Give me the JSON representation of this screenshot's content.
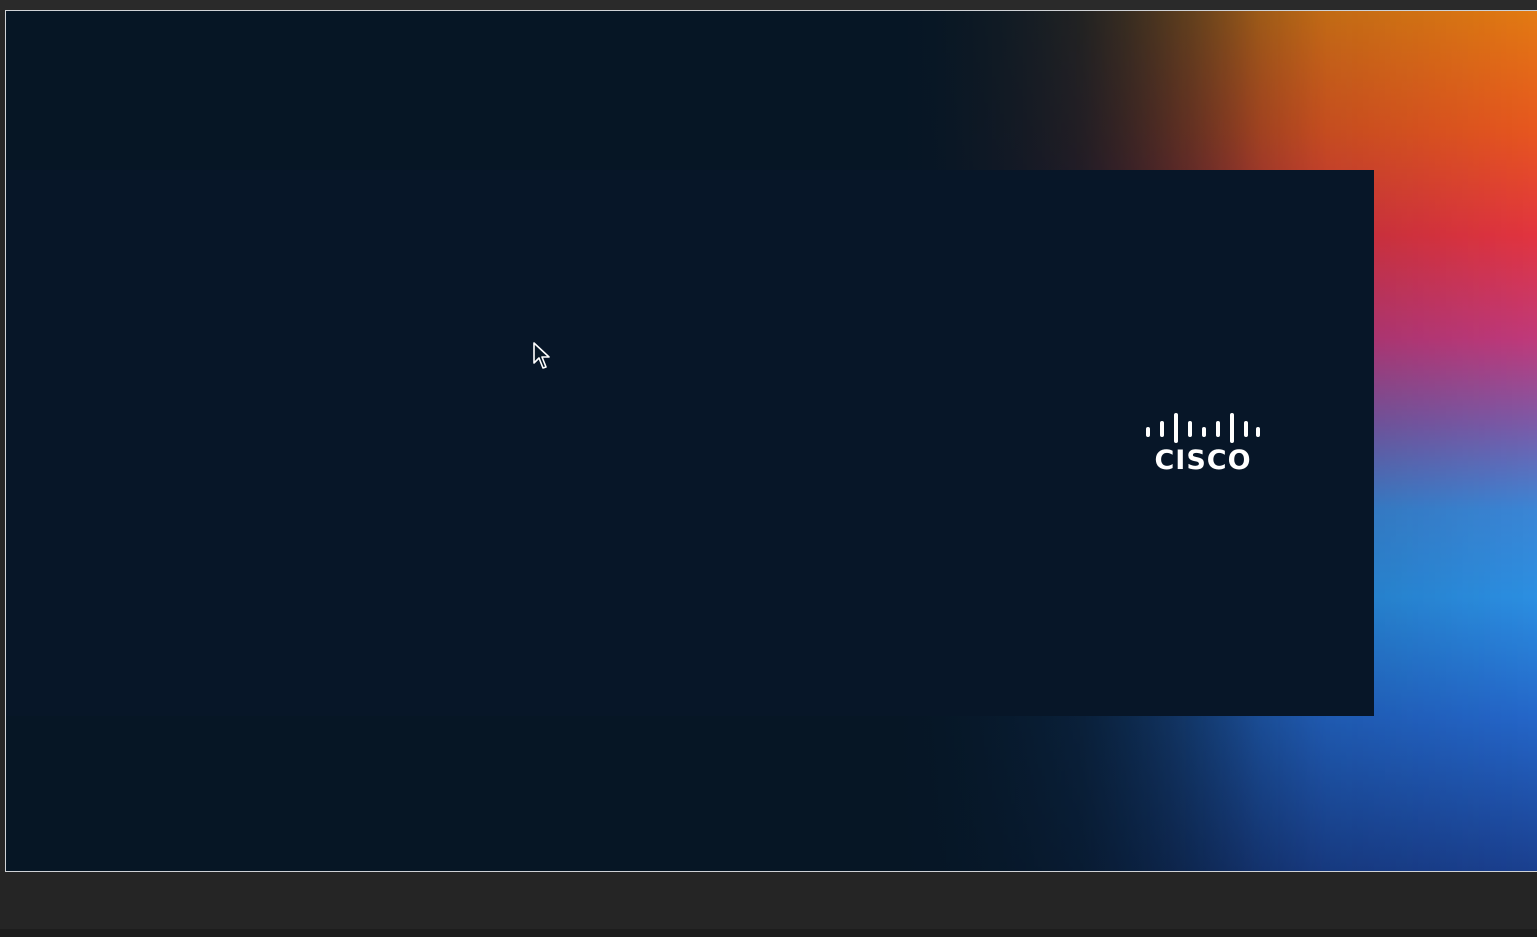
{
  "screen_share": {
    "logo": {
      "icon": "cisco-logo-bars-icon",
      "wordmark": "CISCO"
    },
    "cursor": {
      "icon": "arrow-pointer-icon"
    },
    "colors": {
      "background": "#061625",
      "card": "#071628",
      "logo": "#ffffff",
      "gradient_orange": "#e37a12",
      "gradient_red": "#e2343f",
      "gradient_magenta": "#c0397a",
      "gradient_blue": "#2b8fe2"
    }
  }
}
